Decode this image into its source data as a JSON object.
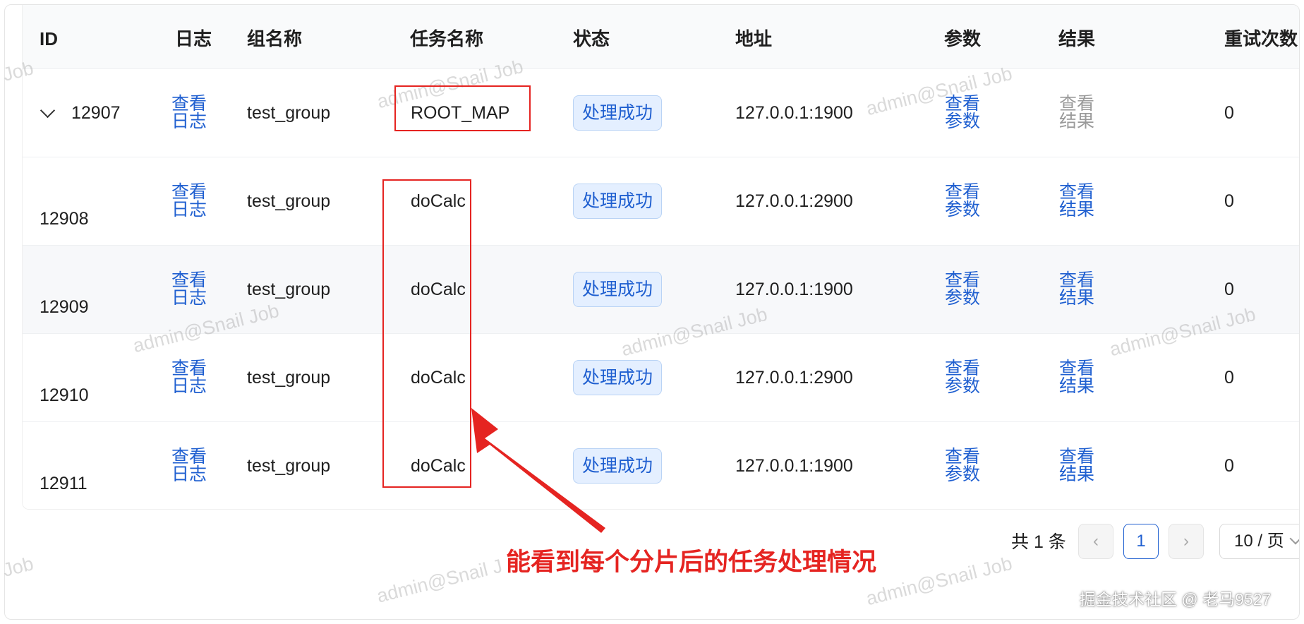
{
  "table": {
    "headers": {
      "id": "ID",
      "log": "日志",
      "group": "组名称",
      "task": "任务名称",
      "status": "状态",
      "address": "地址",
      "params": "参数",
      "result": "结果",
      "retry": "重试次数"
    },
    "rows": [
      {
        "id": "12907",
        "log_l1": "查看",
        "log_l2": "日志",
        "group": "test_group",
        "task": "ROOT_MAP",
        "status": "处理成功",
        "address": "127.0.0.1:1900",
        "params_l1": "查看",
        "params_l2": "参数",
        "result_l1": "查看",
        "result_l2": "结果",
        "retry": "0",
        "expanded": true,
        "result_enabled": false
      },
      {
        "id": "12908",
        "log_l1": "查看",
        "log_l2": "日志",
        "group": "test_group",
        "task": "doCalc",
        "status": "处理成功",
        "address": "127.0.0.1:2900",
        "params_l1": "查看",
        "params_l2": "参数",
        "result_l1": "查看",
        "result_l2": "结果",
        "retry": "0",
        "result_enabled": true
      },
      {
        "id": "12909",
        "log_l1": "查看",
        "log_l2": "日志",
        "group": "test_group",
        "task": "doCalc",
        "status": "处理成功",
        "address": "127.0.0.1:1900",
        "params_l1": "查看",
        "params_l2": "参数",
        "result_l1": "查看",
        "result_l2": "结果",
        "retry": "0",
        "result_enabled": true
      },
      {
        "id": "12910",
        "log_l1": "查看",
        "log_l2": "日志",
        "group": "test_group",
        "task": "doCalc",
        "status": "处理成功",
        "address": "127.0.0.1:2900",
        "params_l1": "查看",
        "params_l2": "参数",
        "result_l1": "查看",
        "result_l2": "结果",
        "retry": "0",
        "result_enabled": true
      },
      {
        "id": "12911",
        "log_l1": "查看",
        "log_l2": "日志",
        "group": "test_group",
        "task": "doCalc",
        "status": "处理成功",
        "address": "127.0.0.1:1900",
        "params_l1": "查看",
        "params_l2": "参数",
        "result_l1": "查看",
        "result_l2": "结果",
        "retry": "0",
        "result_enabled": true
      }
    ]
  },
  "pagination": {
    "total_label": "共 1 条",
    "prev_icon": "‹",
    "current_page": "1",
    "next_icon": "›",
    "page_size": "10 / 页"
  },
  "annotation": {
    "text": "能看到每个分片后的任务处理情况"
  },
  "watermark": {
    "text": "admin@Snail Job",
    "fragment_left": "Job",
    "fragment_cut": "admin@Snail J"
  },
  "credit": {
    "text": "掘金技术社区 @ 老马9527"
  },
  "colors": {
    "link": "#1f5fd0",
    "badge_bg": "#e4efff",
    "annotation_red": "#e52421",
    "header_bg": "#f9fafb"
  }
}
